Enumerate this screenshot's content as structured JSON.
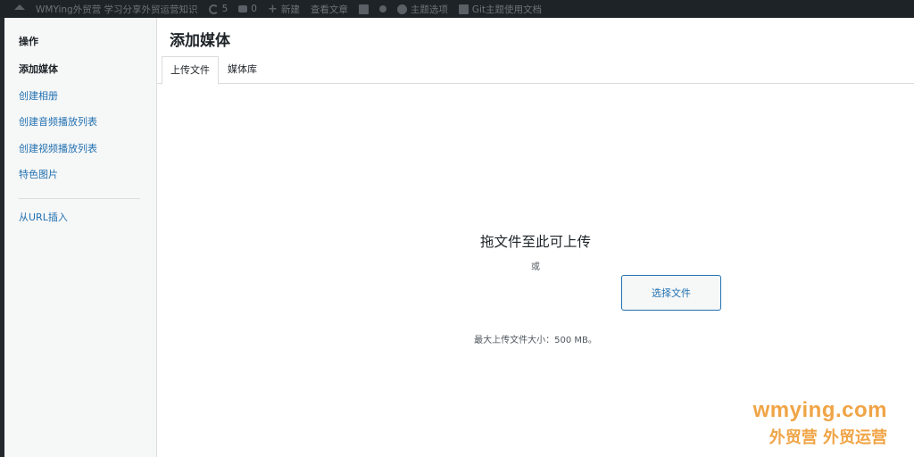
{
  "adminbar": {
    "site_title": "WMYing外贸营 学习分享外贸运营知识",
    "updates_count": "5",
    "comments_count": "0",
    "new_label": "新建",
    "view_label": "查看文章",
    "theme_options": "主题选项",
    "docs_label": "Git主题使用文档"
  },
  "sidebar": {
    "heading": "操作",
    "items": [
      {
        "label": "添加媒体"
      },
      {
        "label": "创建相册"
      },
      {
        "label": "创建音频播放列表"
      },
      {
        "label": "创建视频播放列表"
      },
      {
        "label": "特色图片"
      }
    ],
    "url_item": "从URL插入"
  },
  "frame": {
    "title": "添加媒体",
    "tabs": [
      {
        "label": "上传文件"
      },
      {
        "label": "媒体库"
      }
    ]
  },
  "uploader": {
    "drop_title": "拖文件至此可上传",
    "or_text": "或",
    "select_button": "选择文件",
    "max_size": "最大上传文件大小：500 MB。"
  },
  "watermark": {
    "line1": "wmying.com",
    "line2": "外贸营 外贸运营"
  }
}
